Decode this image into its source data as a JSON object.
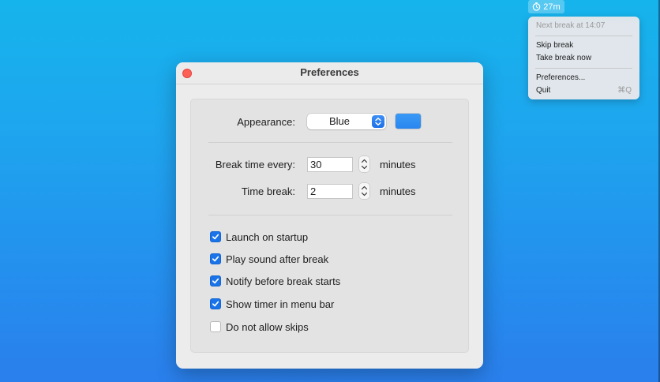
{
  "menubar": {
    "timer_text": "27m",
    "timer_icon": "timer-icon"
  },
  "menu": {
    "next_break": "Next break at 14:07",
    "skip_break": "Skip break",
    "take_break_now": "Take break now",
    "preferences": "Preferences...",
    "quit": "Quit",
    "quit_shortcut": "⌘Q"
  },
  "window": {
    "title": "Preferences"
  },
  "prefs": {
    "appearance_label": "Appearance:",
    "appearance_value": "Blue",
    "appearance_color": "#2a86ef",
    "break_every_label": "Break time every:",
    "break_every_value": "30",
    "break_every_unit": "minutes",
    "time_break_label": "Time break:",
    "time_break_value": "2",
    "time_break_unit": "minutes"
  },
  "options": [
    {
      "label": "Launch on startup",
      "checked": true
    },
    {
      "label": "Play sound after break",
      "checked": true
    },
    {
      "label": "Notify before break starts",
      "checked": true
    },
    {
      "label": "Show timer in menu bar",
      "checked": true
    },
    {
      "label": "Do not allow skips",
      "checked": false
    }
  ],
  "colors": {
    "accent": "#1a73e8",
    "close_button": "#fe5f57"
  }
}
